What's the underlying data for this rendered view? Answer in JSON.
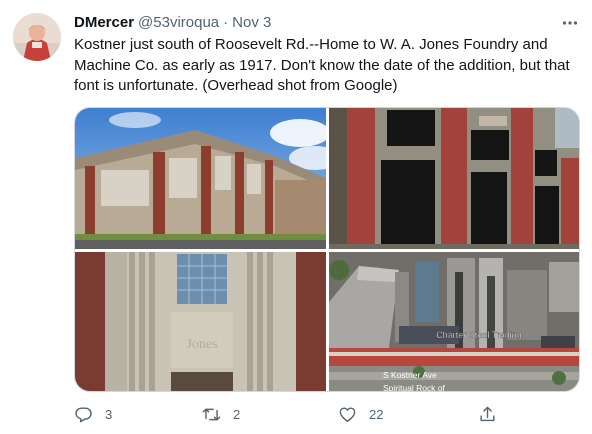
{
  "tweet": {
    "display_name": "DMercer",
    "handle": "@53viroqua",
    "separator": "·",
    "timestamp": "Nov 3",
    "text": "Kostner just south of Roosevelt Rd.--Home to W. A. Jones Foundry and Machine Co. as early as 1917. Don't know the date of the addition, but that font is unfortunate. (Overhead shot from Google)",
    "media": [
      {
        "icon": "photo-brick-factory-street"
      },
      {
        "icon": "photo-brick-facade-windows"
      },
      {
        "icon": "photo-stone-entrance-jones-sign"
      },
      {
        "icon": "photo-aerial-view"
      }
    ],
    "map_labels": {
      "business": "Charter Steel Trading",
      "street": "S Kostner Ave",
      "church": "Spiritual Rock of"
    },
    "sign_text": "Jones",
    "actions": {
      "reply_count": "3",
      "retweet_count": "2",
      "like_count": "22"
    }
  },
  "colors": {
    "text_primary": "#0f1419",
    "text_secondary": "#536471",
    "border": "#cfd9de"
  }
}
